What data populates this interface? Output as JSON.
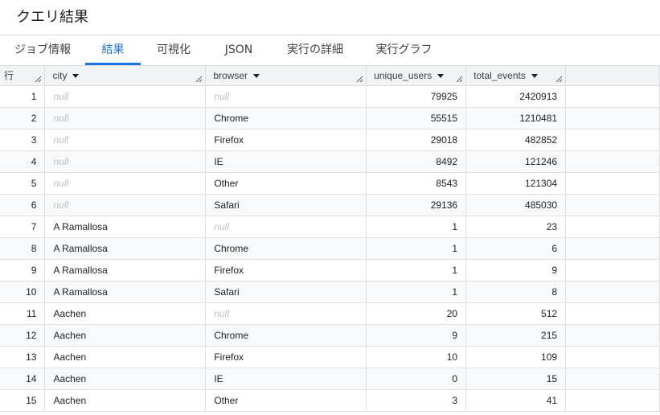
{
  "title": "クエリ結果",
  "tabs": [
    {
      "label": "ジョブ情報",
      "active": false
    },
    {
      "label": "結果",
      "active": true
    },
    {
      "label": "可視化",
      "active": false
    },
    {
      "label": "JSON",
      "active": false
    },
    {
      "label": "実行の詳細",
      "active": false
    },
    {
      "label": "実行グラフ",
      "active": false
    }
  ],
  "table": {
    "row_header": "行",
    "columns": [
      "city",
      "browser",
      "unique_users",
      "total_events"
    ],
    "null_text": "null",
    "rows": [
      {
        "n": "1",
        "city": null,
        "browser": null,
        "unique_users": "79925",
        "total_events": "2420913"
      },
      {
        "n": "2",
        "city": null,
        "browser": "Chrome",
        "unique_users": "55515",
        "total_events": "1210481"
      },
      {
        "n": "3",
        "city": null,
        "browser": "Firefox",
        "unique_users": "29018",
        "total_events": "482852"
      },
      {
        "n": "4",
        "city": null,
        "browser": "IE",
        "unique_users": "8492",
        "total_events": "121246"
      },
      {
        "n": "5",
        "city": null,
        "browser": "Other",
        "unique_users": "8543",
        "total_events": "121304"
      },
      {
        "n": "6",
        "city": null,
        "browser": "Safari",
        "unique_users": "29136",
        "total_events": "485030"
      },
      {
        "n": "7",
        "city": "A Ramallosa",
        "browser": null,
        "unique_users": "1",
        "total_events": "23"
      },
      {
        "n": "8",
        "city": "A Ramallosa",
        "browser": "Chrome",
        "unique_users": "1",
        "total_events": "6"
      },
      {
        "n": "9",
        "city": "A Ramallosa",
        "browser": "Firefox",
        "unique_users": "1",
        "total_events": "9"
      },
      {
        "n": "10",
        "city": "A Ramallosa",
        "browser": "Safari",
        "unique_users": "1",
        "total_events": "8"
      },
      {
        "n": "11",
        "city": "Aachen",
        "browser": null,
        "unique_users": "20",
        "total_events": "512"
      },
      {
        "n": "12",
        "city": "Aachen",
        "browser": "Chrome",
        "unique_users": "9",
        "total_events": "215"
      },
      {
        "n": "13",
        "city": "Aachen",
        "browser": "Firefox",
        "unique_users": "10",
        "total_events": "109"
      },
      {
        "n": "14",
        "city": "Aachen",
        "browser": "IE",
        "unique_users": "0",
        "total_events": "15"
      },
      {
        "n": "15",
        "city": "Aachen",
        "browser": "Other",
        "unique_users": "3",
        "total_events": "41"
      }
    ]
  },
  "colors": {
    "accent": "#1a73e8",
    "header_bg": "#f1f3f4",
    "stripe_bg": "#f8f9fa",
    "null_text": "#bdc1c6"
  }
}
